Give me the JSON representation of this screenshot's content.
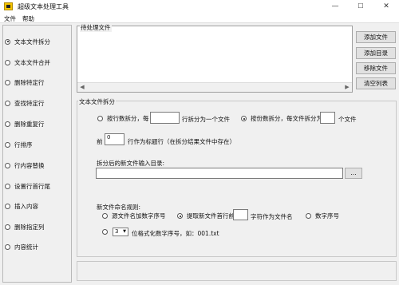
{
  "window": {
    "title": "超级文本处理工具",
    "minimize": "—",
    "maximize": "☐",
    "close": "✕"
  },
  "menu": [
    "文件",
    "帮助"
  ],
  "sidebar": {
    "items": [
      {
        "label": "文本文件拆分",
        "selected": true
      },
      {
        "label": "文本文件合并",
        "selected": false
      },
      {
        "label": "删除特定行",
        "selected": false
      },
      {
        "label": "查找特定行",
        "selected": false
      },
      {
        "label": "删除重复行",
        "selected": false
      },
      {
        "label": "行排序",
        "selected": false
      },
      {
        "label": "行内容替换",
        "selected": false
      },
      {
        "label": "设置行首行尾",
        "selected": false
      },
      {
        "label": "插入内容",
        "selected": false
      },
      {
        "label": "删除指定列",
        "selected": false
      },
      {
        "label": "内容统计",
        "selected": false
      }
    ]
  },
  "filelist": {
    "label": "待处理文件",
    "scroll_left": "◀",
    "scroll_right": "▶"
  },
  "buttons": {
    "add_file": "添加文件",
    "add_dir": "添加目录",
    "remove_file": "移除文件",
    "clear_list": "清空列表"
  },
  "split": {
    "group_label": "文本文件拆分",
    "by_lines_label": "按行数拆分，每",
    "by_lines_value": "",
    "by_lines_suffix": "行拆分为一个文件",
    "by_count_label": "按份数拆分，每文件拆分为",
    "by_count_value": "",
    "by_count_suffix": "个文件",
    "header_prefix": "前",
    "header_value": "0",
    "header_suffix": "行作为标题行（在拆分结果文件中存在）",
    "output_dir_label": "拆分后的新文件输入目录:",
    "output_dir_value": "",
    "browse": "...",
    "naming_label": "新文件命名规则:",
    "opt_original_seq": "源文件名加数字序号",
    "opt_first_line_prefix": "提取新文件首行前",
    "first_line_chars": "",
    "opt_first_line_suffix": "字符作为文件名",
    "opt_digit_seq": "数字序号",
    "format_digits": "3",
    "format_suffix": "位格式化数字序号，如：001.txt",
    "select_arrow": "▼"
  }
}
